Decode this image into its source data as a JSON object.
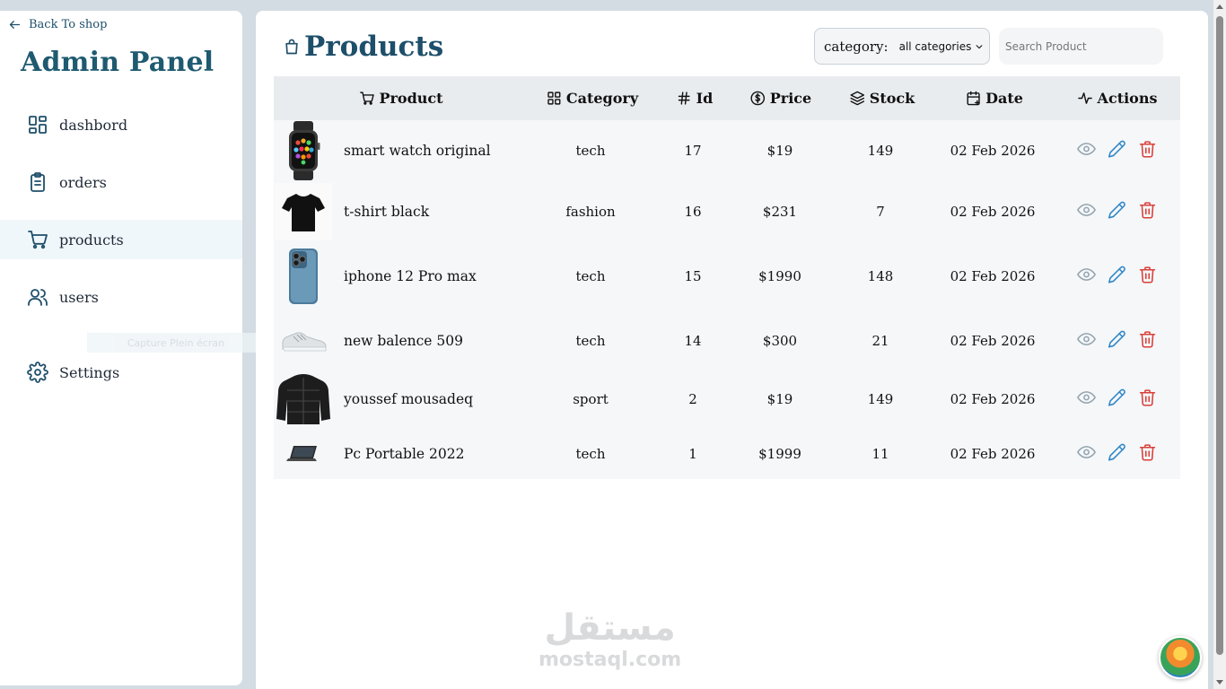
{
  "sidebar": {
    "back_label": "Back To shop",
    "title": "Admin Panel",
    "items": [
      {
        "label": "dashbord",
        "icon": "layout-grid-icon"
      },
      {
        "label": "orders",
        "icon": "clipboard-icon"
      },
      {
        "label": "products",
        "icon": "cart-icon",
        "active": true
      },
      {
        "label": "users",
        "icon": "users-icon"
      },
      {
        "label": "Settings",
        "icon": "gear-icon"
      }
    ],
    "ghost_text": "Capture Plein écran"
  },
  "main": {
    "title": "Products",
    "title_icon": "shopping-bag-icon",
    "filter": {
      "label": "category:",
      "selected": "all categories"
    },
    "search": {
      "placeholder": "Search Product",
      "value": ""
    }
  },
  "table": {
    "columns": [
      {
        "label": "Product",
        "icon": "cart-icon"
      },
      {
        "label": "Category",
        "icon": "layout-grid-icon"
      },
      {
        "label": "Id",
        "icon": "hash-icon"
      },
      {
        "label": "Price",
        "icon": "dollar-circle-icon"
      },
      {
        "label": "Stock",
        "icon": "layers-icon"
      },
      {
        "label": "Date",
        "icon": "calendar-icon"
      },
      {
        "label": "Actions",
        "icon": "activity-icon"
      }
    ],
    "rows": [
      {
        "name": "smart watch original",
        "category": "tech",
        "id": "17",
        "price": "$19",
        "stock": "149",
        "date": "02 Feb 2026",
        "image": "smartwatch"
      },
      {
        "name": "t-shirt black",
        "category": "fashion",
        "id": "16",
        "price": "$231",
        "stock": "7",
        "date": "02 Feb 2026",
        "image": "tshirt"
      },
      {
        "name": "iphone 12 Pro max",
        "category": "tech",
        "id": "15",
        "price": "$1990",
        "stock": "148",
        "date": "02 Feb 2026",
        "image": "iphone"
      },
      {
        "name": "new balence 509",
        "category": "tech",
        "id": "14",
        "price": "$300",
        "stock": "21",
        "date": "02 Feb 2026",
        "image": "sneaker"
      },
      {
        "name": "youssef mousadeq",
        "category": "sport",
        "id": "2",
        "price": "$19",
        "stock": "149",
        "date": "02 Feb 2026",
        "image": "jacket"
      },
      {
        "name": "Pc Portable 2022",
        "category": "tech",
        "id": "1",
        "price": "$1999",
        "stock": "11",
        "date": "02 Feb 2026",
        "image": "laptop"
      }
    ],
    "action_icons": [
      "eye-icon",
      "pencil-icon",
      "trash-icon"
    ]
  },
  "watermark": {
    "arabic": "مستقل",
    "latin": "mostaql.com"
  },
  "colors": {
    "accent": "#1e4f6a",
    "active_bg": "#f0f7fa",
    "view": "#93a4ae",
    "edit": "#2f86c8",
    "delete": "#d9403a"
  }
}
